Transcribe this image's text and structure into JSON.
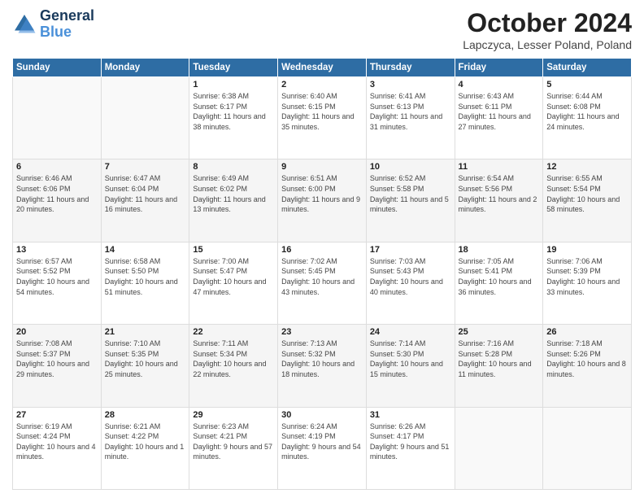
{
  "header": {
    "logo_line1": "General",
    "logo_line2": "Blue",
    "title": "October 2024",
    "location": "Lapczyca, Lesser Poland, Poland"
  },
  "weekdays": [
    "Sunday",
    "Monday",
    "Tuesday",
    "Wednesday",
    "Thursday",
    "Friday",
    "Saturday"
  ],
  "weeks": [
    [
      {
        "num": "",
        "info": ""
      },
      {
        "num": "",
        "info": ""
      },
      {
        "num": "1",
        "info": "Sunrise: 6:38 AM\nSunset: 6:17 PM\nDaylight: 11 hours and 38 minutes."
      },
      {
        "num": "2",
        "info": "Sunrise: 6:40 AM\nSunset: 6:15 PM\nDaylight: 11 hours and 35 minutes."
      },
      {
        "num": "3",
        "info": "Sunrise: 6:41 AM\nSunset: 6:13 PM\nDaylight: 11 hours and 31 minutes."
      },
      {
        "num": "4",
        "info": "Sunrise: 6:43 AM\nSunset: 6:11 PM\nDaylight: 11 hours and 27 minutes."
      },
      {
        "num": "5",
        "info": "Sunrise: 6:44 AM\nSunset: 6:08 PM\nDaylight: 11 hours and 24 minutes."
      }
    ],
    [
      {
        "num": "6",
        "info": "Sunrise: 6:46 AM\nSunset: 6:06 PM\nDaylight: 11 hours and 20 minutes."
      },
      {
        "num": "7",
        "info": "Sunrise: 6:47 AM\nSunset: 6:04 PM\nDaylight: 11 hours and 16 minutes."
      },
      {
        "num": "8",
        "info": "Sunrise: 6:49 AM\nSunset: 6:02 PM\nDaylight: 11 hours and 13 minutes."
      },
      {
        "num": "9",
        "info": "Sunrise: 6:51 AM\nSunset: 6:00 PM\nDaylight: 11 hours and 9 minutes."
      },
      {
        "num": "10",
        "info": "Sunrise: 6:52 AM\nSunset: 5:58 PM\nDaylight: 11 hours and 5 minutes."
      },
      {
        "num": "11",
        "info": "Sunrise: 6:54 AM\nSunset: 5:56 PM\nDaylight: 11 hours and 2 minutes."
      },
      {
        "num": "12",
        "info": "Sunrise: 6:55 AM\nSunset: 5:54 PM\nDaylight: 10 hours and 58 minutes."
      }
    ],
    [
      {
        "num": "13",
        "info": "Sunrise: 6:57 AM\nSunset: 5:52 PM\nDaylight: 10 hours and 54 minutes."
      },
      {
        "num": "14",
        "info": "Sunrise: 6:58 AM\nSunset: 5:50 PM\nDaylight: 10 hours and 51 minutes."
      },
      {
        "num": "15",
        "info": "Sunrise: 7:00 AM\nSunset: 5:47 PM\nDaylight: 10 hours and 47 minutes."
      },
      {
        "num": "16",
        "info": "Sunrise: 7:02 AM\nSunset: 5:45 PM\nDaylight: 10 hours and 43 minutes."
      },
      {
        "num": "17",
        "info": "Sunrise: 7:03 AM\nSunset: 5:43 PM\nDaylight: 10 hours and 40 minutes."
      },
      {
        "num": "18",
        "info": "Sunrise: 7:05 AM\nSunset: 5:41 PM\nDaylight: 10 hours and 36 minutes."
      },
      {
        "num": "19",
        "info": "Sunrise: 7:06 AM\nSunset: 5:39 PM\nDaylight: 10 hours and 33 minutes."
      }
    ],
    [
      {
        "num": "20",
        "info": "Sunrise: 7:08 AM\nSunset: 5:37 PM\nDaylight: 10 hours and 29 minutes."
      },
      {
        "num": "21",
        "info": "Sunrise: 7:10 AM\nSunset: 5:35 PM\nDaylight: 10 hours and 25 minutes."
      },
      {
        "num": "22",
        "info": "Sunrise: 7:11 AM\nSunset: 5:34 PM\nDaylight: 10 hours and 22 minutes."
      },
      {
        "num": "23",
        "info": "Sunrise: 7:13 AM\nSunset: 5:32 PM\nDaylight: 10 hours and 18 minutes."
      },
      {
        "num": "24",
        "info": "Sunrise: 7:14 AM\nSunset: 5:30 PM\nDaylight: 10 hours and 15 minutes."
      },
      {
        "num": "25",
        "info": "Sunrise: 7:16 AM\nSunset: 5:28 PM\nDaylight: 10 hours and 11 minutes."
      },
      {
        "num": "26",
        "info": "Sunrise: 7:18 AM\nSunset: 5:26 PM\nDaylight: 10 hours and 8 minutes."
      }
    ],
    [
      {
        "num": "27",
        "info": "Sunrise: 6:19 AM\nSunset: 4:24 PM\nDaylight: 10 hours and 4 minutes."
      },
      {
        "num": "28",
        "info": "Sunrise: 6:21 AM\nSunset: 4:22 PM\nDaylight: 10 hours and 1 minute."
      },
      {
        "num": "29",
        "info": "Sunrise: 6:23 AM\nSunset: 4:21 PM\nDaylight: 9 hours and 57 minutes."
      },
      {
        "num": "30",
        "info": "Sunrise: 6:24 AM\nSunset: 4:19 PM\nDaylight: 9 hours and 54 minutes."
      },
      {
        "num": "31",
        "info": "Sunrise: 6:26 AM\nSunset: 4:17 PM\nDaylight: 9 hours and 51 minutes."
      },
      {
        "num": "",
        "info": ""
      },
      {
        "num": "",
        "info": ""
      }
    ]
  ]
}
